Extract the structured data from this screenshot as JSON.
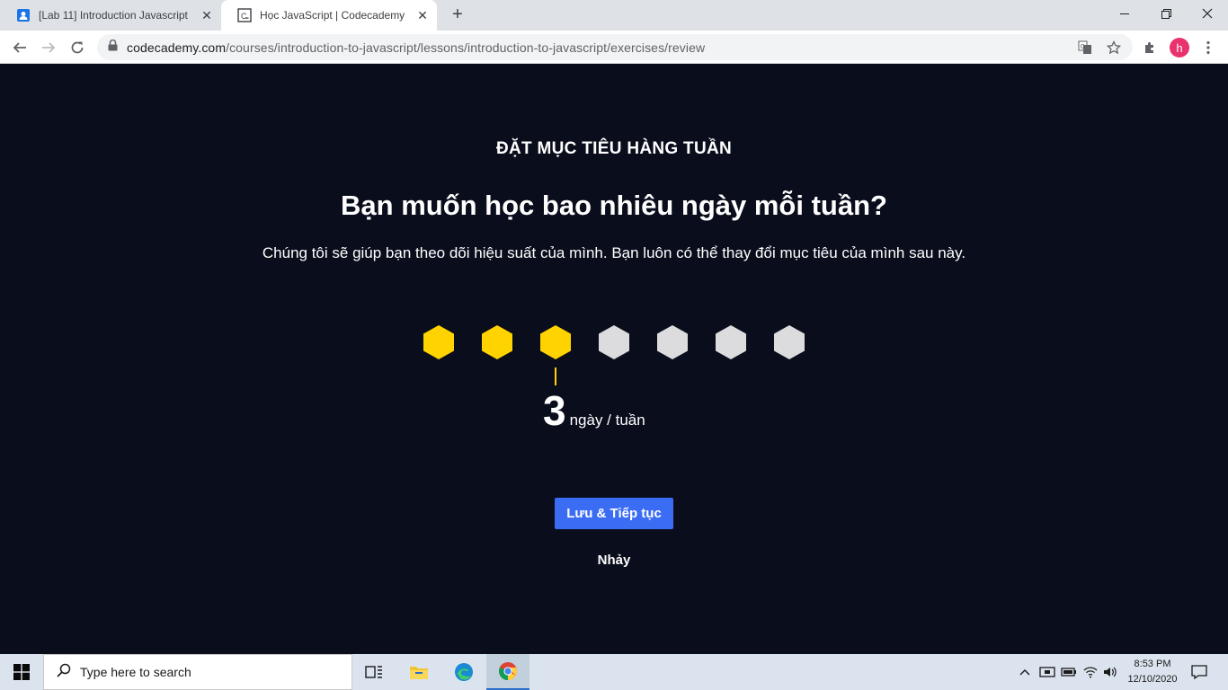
{
  "browser": {
    "tabs": [
      {
        "title": "[Lab 11] Introduction Javascript",
        "favicon": "person-icon",
        "active": false
      },
      {
        "title": "Học JavaScript | Codecademy",
        "favicon": "codecademy-icon",
        "active": true
      }
    ],
    "url_domain": "codecademy.com",
    "url_path": "/courses/introduction-to-javascript/lessons/introduction-to-javascript/exercises/review",
    "avatar_letter": "h"
  },
  "page": {
    "eyebrow": "ĐẶT MỤC TIÊU HÀNG TUẦN",
    "heading": "Bạn muốn học bao nhiêu ngày mỗi tuần?",
    "subtitle": "Chúng tôi sẽ giúp bạn theo dõi hiệu suất của mình. Bạn luôn có thể thay đổi mục tiêu của mình sau này.",
    "selected_days": 3,
    "total_days": 7,
    "count_value": "3",
    "count_unit": "ngày / tuần",
    "save_label": "Lưu & Tiếp tục",
    "skip_label": "Nhảy",
    "colors": {
      "active": "#ffd300",
      "inactive": "#dcdcde",
      "button": "#3a6cf4",
      "background": "#0a0d1c"
    }
  },
  "taskbar": {
    "search_placeholder": "Type here to search",
    "time": "8:53 PM",
    "date": "12/10/2020"
  }
}
